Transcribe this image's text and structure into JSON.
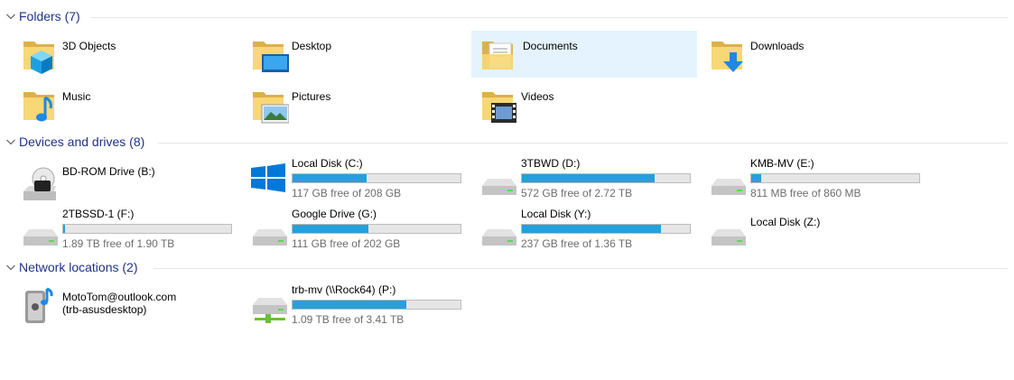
{
  "groups": {
    "folders": {
      "title": "Folders (7)"
    },
    "drives": {
      "title": "Devices and drives (8)"
    },
    "network": {
      "title": "Network locations (2)"
    }
  },
  "folders": [
    {
      "name": "3D Objects",
      "icon": "3d-objects-folder-icon"
    },
    {
      "name": "Desktop",
      "icon": "desktop-folder-icon"
    },
    {
      "name": "Documents",
      "icon": "documents-folder-icon",
      "selected": true
    },
    {
      "name": "Downloads",
      "icon": "downloads-folder-icon"
    },
    {
      "name": "Music",
      "icon": "music-folder-icon"
    },
    {
      "name": "Pictures",
      "icon": "pictures-folder-icon"
    },
    {
      "name": "Videos",
      "icon": "videos-folder-icon"
    }
  ],
  "drives": [
    {
      "name": "BD-ROM Drive (B:)",
      "icon": "bd-rom-drive-icon"
    },
    {
      "name": "Local Disk (C:)",
      "icon": "windows-drive-icon",
      "usage": 0.44,
      "free_text": "117 GB free of 208 GB"
    },
    {
      "name": "3TBWD (D:)",
      "icon": "hard-drive-icon",
      "usage": 0.79,
      "free_text": "572 GB free of 2.72 TB"
    },
    {
      "name": "KMB-MV (E:)",
      "icon": "hard-drive-icon",
      "usage": 0.06,
      "free_text": "811 MB free of 860 MB"
    },
    {
      "name": "2TBSSD-1 (F:)",
      "icon": "hard-drive-icon",
      "usage": 0.01,
      "free_text": "1.89 TB free of 1.90 TB"
    },
    {
      "name": "Google Drive (G:)",
      "icon": "hard-drive-icon",
      "usage": 0.45,
      "free_text": "111 GB free of 202 GB"
    },
    {
      "name": "Local Disk (Y:)",
      "icon": "hard-drive-icon",
      "usage": 0.83,
      "free_text": "237 GB free of 1.36 TB"
    },
    {
      "name": "Local Disk (Z:)",
      "icon": "hard-drive-icon"
    }
  ],
  "network": [
    {
      "name": "MotoTom@outlook.com",
      "sub": "(trb-asusdesktop)",
      "icon": "media-server-icon"
    },
    {
      "name": "trb-mv (\\\\Rock64) (P:)",
      "icon": "network-drive-icon",
      "usage": 0.68,
      "free_text": "1.09 TB free of 3.41 TB"
    }
  ],
  "colors": {
    "group_title": "#1e3287",
    "bar_fill": "#26a0da",
    "selected_bg": "#e5f3ff"
  }
}
